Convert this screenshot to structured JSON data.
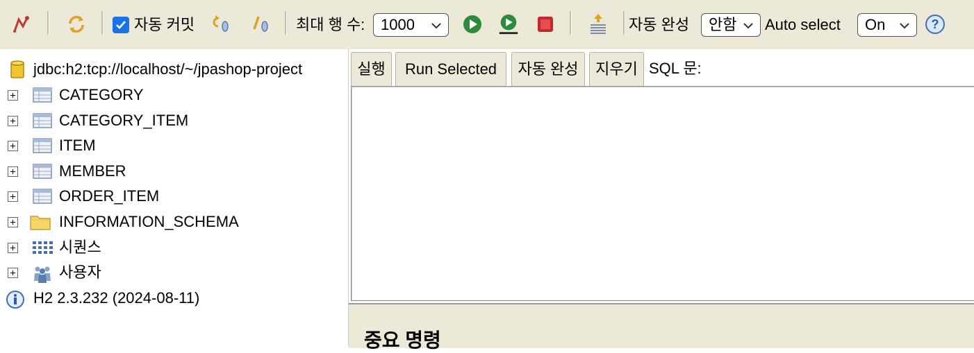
{
  "toolbar": {
    "autocommit_label": "자동 커밋",
    "autocommit_checked": true,
    "max_rows_label": "최대 행 수:",
    "max_rows_value": "1000",
    "autocomplete_label": "자동 완성",
    "autocomplete_value": "안함",
    "autoselect_label": "Auto select",
    "autoselect_value": "On",
    "accent_color": "#1a73e8"
  },
  "tree": {
    "connection": "jdbc:h2:tcp://localhost/~/jpashop-project",
    "items": [
      {
        "label": "CATEGORY",
        "icon": "table-icon"
      },
      {
        "label": "CATEGORY_ITEM",
        "icon": "table-icon"
      },
      {
        "label": "ITEM",
        "icon": "table-icon"
      },
      {
        "label": "MEMBER",
        "icon": "table-icon"
      },
      {
        "label": "ORDER_ITEM",
        "icon": "table-icon"
      },
      {
        "label": "INFORMATION_SCHEMA",
        "icon": "folder-icon"
      },
      {
        "label": "시퀀스",
        "icon": "sequence-icon"
      },
      {
        "label": "사용자",
        "icon": "users-icon"
      }
    ],
    "version": "H2 2.3.232 (2024-08-11)"
  },
  "editor": {
    "run_label": "실행",
    "run_selected_label": "Run Selected",
    "autocomplete_label": "자동 완성",
    "clear_label": "지우기",
    "sql_label": "SQL 문:",
    "sql_text": ""
  },
  "result": {
    "heading": "중요 명령"
  }
}
